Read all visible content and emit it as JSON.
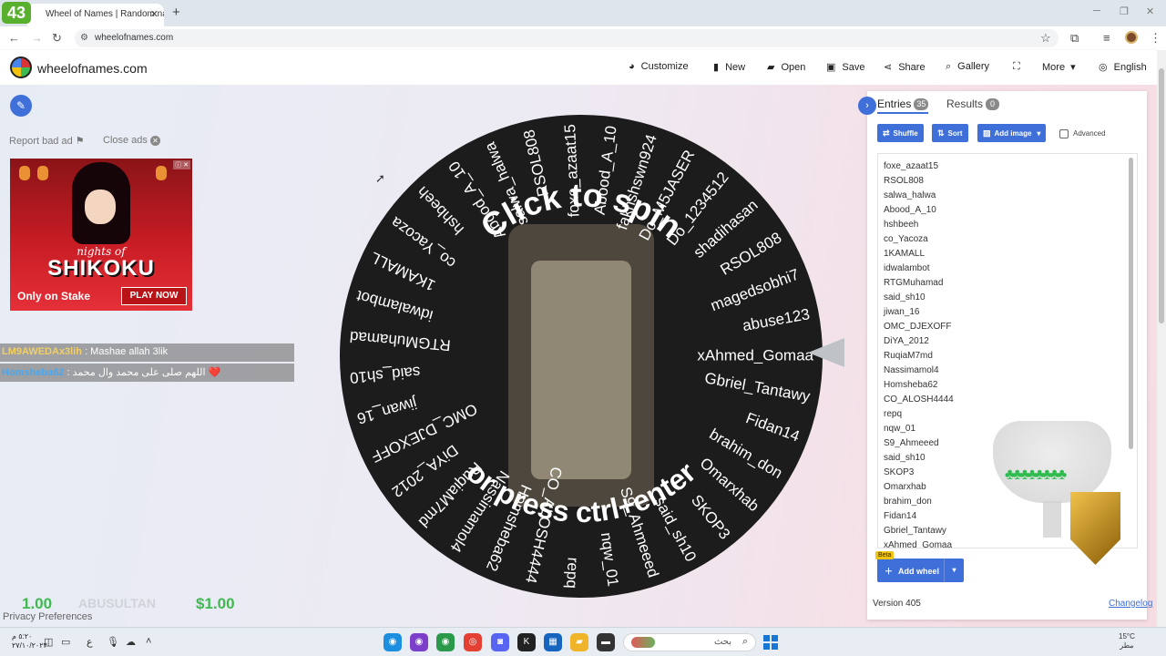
{
  "browser": {
    "badge": "43",
    "tab_title": "Wheel of Names | Random name picker",
    "new_tab": "+",
    "url": "wheelofnames.com"
  },
  "app": {
    "brand": "wheelofnames.com",
    "menu": {
      "customize": "Customize",
      "new": "New",
      "open": "Open",
      "save": "Save",
      "share": "Share",
      "gallery": "Gallery",
      "more": "More",
      "language": "English"
    }
  },
  "sidebar": {
    "report_ad": "Report bad ad",
    "close_ads": "Close ads"
  },
  "ad": {
    "nights": "nights of",
    "title": "SHIKOKU",
    "only_on": "Only on Stake",
    "play_now": "PLAY NOW",
    "adchoices": "ⓘ ✕"
  },
  "chat": [
    {
      "user": "LM9AWEDAx3lih",
      "message": " : Mashae allah 3lik"
    },
    {
      "user": "Homsheba62",
      "message": " : اللهم صلى على محمد وال محمد ❤️"
    }
  ],
  "stream_overlay": {
    "price": "1.00",
    "name": "ABUSULTAN",
    "amount": "$1.00"
  },
  "privacy": "Privacy Preferences",
  "wheel": {
    "spin_text": "Click to spin",
    "press_text": "or press ctrl+enter",
    "slices": [
      "xAhmed_Gomaa",
      "Gbriel_Tantawy",
      "Fidan14",
      "brahim_don",
      "Omarxhab",
      "SKOP3",
      "said_sh10",
      "S9_Ahmeeed",
      "nqw_01",
      "repq",
      "CO_ALOSH4444",
      "Homsheba62",
      "Nassimamol4",
      "RuqiaM7md",
      "DiYA_2012",
      "OMC_DJEXOFF",
      "jiwan_16",
      "said_sh10",
      "RTGMuhamad",
      "idwalambot",
      "1KAMALL",
      "co_Yacoza",
      "hshbeeh",
      "Abood_A_10",
      "salwa_halwa",
      "RSOL808",
      "foxe_azaat15",
      "Abood_A_10",
      "fakhshswn924",
      "Do_M5JASER",
      "Do_1234512",
      "shadihasan",
      "RSOL808",
      "magedsobhi7",
      "abuse123"
    ]
  },
  "panel": {
    "entries_tab": "Entries",
    "entries_count": "35",
    "results_tab": "Results",
    "results_count": "0",
    "shuffle": "Shuffle",
    "sort": "Sort",
    "add_image": "Add image",
    "advanced": "Advanced",
    "entries": [
      "foxe_azaat15",
      "RSOL808",
      "salwa_halwa",
      "Abood_A_10",
      "hshbeeh",
      "co_Yacoza",
      "1KAMALL",
      "idwalambot",
      "RTGMuhamad",
      "said_sh10",
      "jiwan_16",
      "OMC_DJEXOFF",
      "DiYA_2012",
      "RuqiaM7md",
      "Nassimamol4",
      "Homsheba62",
      "CO_ALOSH4444",
      "repq",
      "nqw_01",
      "S9_Ahmeeed",
      "said_sh10",
      "SKOP3",
      "Omarxhab",
      "brahim_don",
      "Fidan14",
      "Gbriel_Tantawy",
      "xAhmed_Gomaa"
    ],
    "add_wheel": "Add wheel",
    "beta": "Beta",
    "version": "Version 405",
    "changelog": "Changelog"
  },
  "taskbar": {
    "time": "٥:٢٠ م",
    "date": "٢٧/١٠/٢٠٢٣",
    "search_placeholder": "بحث",
    "temp": "15°C",
    "weather": "مطر"
  },
  "colors": {
    "accent": "#3f6fd8",
    "wheel_dark": "#1c1c1c",
    "price_green": "#3fb950"
  }
}
